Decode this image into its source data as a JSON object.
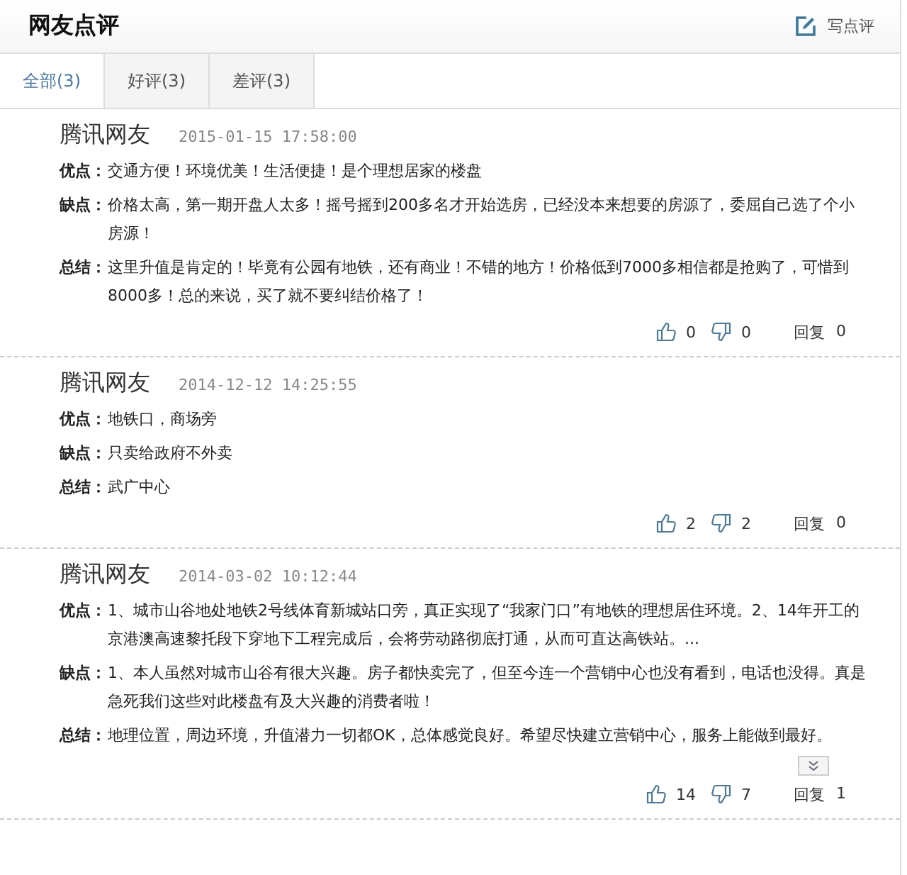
{
  "header": {
    "title": "网友点评",
    "write_button": "写点评"
  },
  "tabs": [
    {
      "label": "全部(3)",
      "selected": true
    },
    {
      "label": "好评(3)",
      "selected": false
    },
    {
      "label": "差评(3)",
      "selected": false
    }
  ],
  "reviews": [
    {
      "author": "腾讯网友",
      "date": "2015-01-15 17:58:00",
      "fields": [
        {
          "label": "优点：",
          "text": "交通方便！环境优美！生活便捷！是个理想居家的楼盘"
        },
        {
          "label": "缺点：",
          "text": "价格太高，第一期开盘人太多！摇号摇到200多名才开始选房，已经没本来想要的房源了，委屈自己选了个小房源！"
        },
        {
          "label": "总结：",
          "text": "这里升值是肯定的！毕竟有公园有地铁，还有商业！不错的地方！价格低到7000多相信都是抢购了，可惜到8000多！总的来说，买了就不要纠结价格了！"
        }
      ],
      "likes": "0",
      "dislikes": "0",
      "reply_label": "回复",
      "replies": "0",
      "expandable": false
    },
    {
      "author": "腾讯网友",
      "date": "2014-12-12 14:25:55",
      "fields": [
        {
          "label": "优点：",
          "text": "地铁口，商场旁"
        },
        {
          "label": "缺点：",
          "text": "只卖给政府不外卖"
        },
        {
          "label": "总结：",
          "text": "武广中心"
        }
      ],
      "likes": "2",
      "dislikes": "2",
      "reply_label": "回复",
      "replies": "0",
      "expandable": false
    },
    {
      "author": "腾讯网友",
      "date": "2014-03-02 10:12:44",
      "fields": [
        {
          "label": "优点：",
          "text": "1、城市山谷地处地铁2号线体育新城站口旁，真正实现了“我家门口”有地铁的理想居住环境。2、14年开工的京港澳高速黎托段下穿地下工程完成后，会将劳动路彻底打通，从而可直达高铁站。..."
        },
        {
          "label": "缺点：",
          "text": "1、本人虽然对城市山谷有很大兴趣。房子都快卖完了，但至今连一个营销中心也没有看到，电话也没得。真是急死我们这些对此楼盘有及大兴趣的消费者啦！"
        },
        {
          "label": "总结：",
          "text": "地理位置，周边环境，升值潜力一切都OK，总体感觉良好。希望尽快建立营销中心，服务上能做到最好。"
        }
      ],
      "likes": "14",
      "dislikes": "7",
      "reply_label": "回复",
      "replies": "1",
      "expandable": true
    }
  ]
}
